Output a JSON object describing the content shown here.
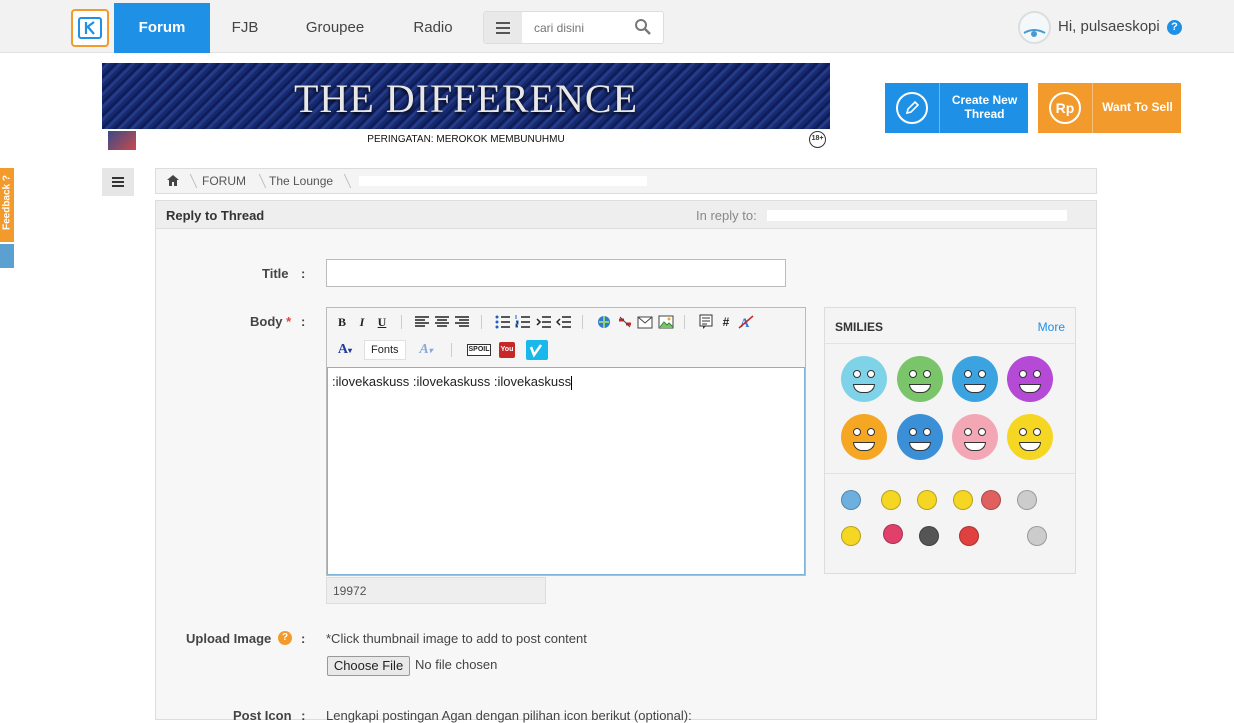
{
  "nav": {
    "items": [
      "Forum",
      "FJB",
      "Groupee",
      "Radio"
    ],
    "search_placeholder": "cari disini",
    "greeting": "Hi, pulsaeskopi",
    "help": "?"
  },
  "banner": {
    "title": "THE DIFFERENCE",
    "warning": "PERINGATAN: MEROKOK MEMBUNUHMU",
    "age_badge": "18+"
  },
  "actions": {
    "create_thread": "Create New Thread",
    "want_to_sell": "Want To Sell",
    "sell_symbol": "Rp"
  },
  "feedback": "Feedback ?",
  "breadcrumb": [
    "FORUM",
    "The Lounge"
  ],
  "reply": {
    "title": "Reply to Thread",
    "in_reply_to": "In reply to:"
  },
  "form": {
    "title_label": "Title",
    "body_label": "Body",
    "required_mark": "*",
    "colon": ":",
    "body_text": ":ilovekaskuss :ilovekaskuss :ilovekaskuss",
    "char_count": "19972",
    "fonts_label": "Fonts",
    "upload_label": "Upload Image",
    "upload_note": "*Click thumbnail image to add to post content",
    "choose_file": "Choose File",
    "no_file": "No file chosen",
    "post_icon_label": "Post Icon",
    "post_icon_note": "Lengkapi postingan Agan dengan pilihan icon berikut (optional):"
  },
  "toolbar": {
    "bold": "B",
    "italic": "I",
    "underline": "U",
    "font_color": "A",
    "spoiler": "SPOIL",
    "youtube": "You",
    "hash": "#"
  },
  "smilies": {
    "title": "SMILIES",
    "more": "More",
    "big_colors": [
      "#7fd3e8",
      "#7ac46a",
      "#3aa3e0",
      "#b44ad6",
      "#f5a623",
      "#3a8fd6",
      "#f3a7b5",
      "#f5d623"
    ],
    "small_colors": [
      "#6db0e0",
      "#f5d623",
      "#f5d623",
      "#f5d623",
      "#e06060",
      "#cccccc",
      "#f5d623",
      "#e0406a",
      "#555555",
      "#e04040",
      "#cccccc"
    ]
  },
  "colors": {
    "accent_blue": "#1e90e6",
    "accent_orange": "#f29b2c"
  }
}
